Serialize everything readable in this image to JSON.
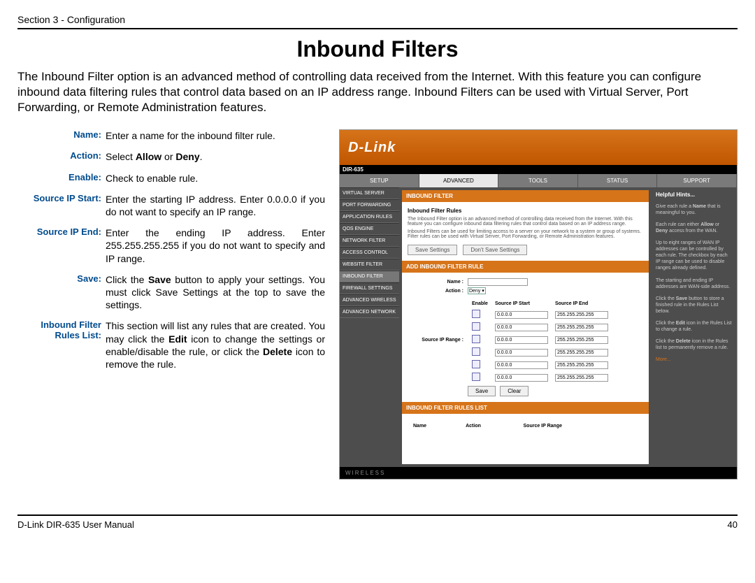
{
  "header": "Section 3 - Configuration",
  "title": "Inbound Filters",
  "intro": "The Inbound Filter option is an advanced method of controlling data received from the Internet. With this feature you can configure inbound data filtering rules that control data based on an IP address range.  Inbound Filters can be used with Virtual Server, Port Forwarding, or Remote Administration features.",
  "defs": [
    {
      "label": "Name:",
      "html": "Enter a name for the inbound filter rule."
    },
    {
      "label": "Action:",
      "html": "Select <b>Allow</b> or <b>Deny</b>."
    },
    {
      "label": "Enable:",
      "html": "Check to enable rule."
    },
    {
      "label": "Source IP Start:",
      "html": "Enter the starting IP address. Enter 0.0.0.0 if you do not want to specify an IP range."
    },
    {
      "label": "Source IP End:",
      "html": "Enter the ending IP address. Enter 255.255.255.255 if you do not want to specify and IP range."
    },
    {
      "label": "Save:",
      "html": "Click the <b>Save</b> button to apply your settings. You must click Save Settings at the top to save the settings."
    },
    {
      "label": "Inbound Filter Rules List:",
      "html": "This section will list any rules that are created. You may click the <b>Edit</b> icon to change the settings or enable/disable the rule, or click the <b>Delete</b> icon to remove the rule."
    }
  ],
  "shot": {
    "logo": "D-Link",
    "model": "DIR-635",
    "tabs": [
      "SETUP",
      "ADVANCED",
      "TOOLS",
      "STATUS",
      "SUPPORT"
    ],
    "active_tab": 1,
    "side": [
      "VIRTUAL SERVER",
      "PORT FORWARDING",
      "APPLICATION RULES",
      "QOS ENGINE",
      "NETWORK FILTER",
      "ACCESS CONTROL",
      "WEBSITE FILTER",
      "INBOUND FILTER",
      "FIREWALL SETTINGS",
      "ADVANCED WIRELESS",
      "ADVANCED NETWORK"
    ],
    "active_side": 7,
    "panel_title": "INBOUND FILTER",
    "rules_title": "Inbound Filter Rules",
    "rules_desc1": "The Inbound Filter option is an advanced method of controlling data received from the Internet. With this feature you can configure inbound data filtering rules that control data based on an IP address range.",
    "rules_desc2": "Inbound Filters can be used for limiting access to a server on your network to a system or group of systems. Filter rules can be used with Virtual Server, Port Forwarding, or Remote Administration features.",
    "btn_save": "Save Settings",
    "btn_dont": "Don't Save Settings",
    "add_title": "ADD INBOUND FILTER RULE",
    "lbl_name": "Name :",
    "lbl_action": "Action :",
    "action_val": "Deny",
    "lbl_range": "Source IP Range :",
    "col_enable": "Enable",
    "col_start": "Source IP Start",
    "col_end": "Source IP End",
    "ip_start": "0.0.0.0",
    "ip_end": "255.255.255.255",
    "btn_save2": "Save",
    "btn_clear": "Clear",
    "list_title": "INBOUND FILTER RULES LIST",
    "list_cols": [
      "Name",
      "Action",
      "Source IP Range"
    ],
    "hints_title": "Helpful Hints...",
    "hints": [
      "Give each rule a <b>Name</b> that is meaningful to you.",
      "Each rule can either <b>Allow</b> or <b>Deny</b> access from the WAN.",
      "Up to eight ranges of WAN IP addresses can be controlled by each rule. The checkbox by each IP range can be used to disable ranges already defined.",
      "The starting and ending IP addresses are WAN-side address.",
      "Click the <b>Save</b> button to store a finished rule in the Rules List below.",
      "Click the <b>Edit</b> icon in the Rules List to change a rule.",
      "Click the <b>Delete</b> icon in the Rules list to permanently remove a rule."
    ],
    "more": "More...",
    "wireless": "WIRELESS"
  },
  "footer_left": "D-Link DIR-635 User Manual",
  "footer_right": "40"
}
